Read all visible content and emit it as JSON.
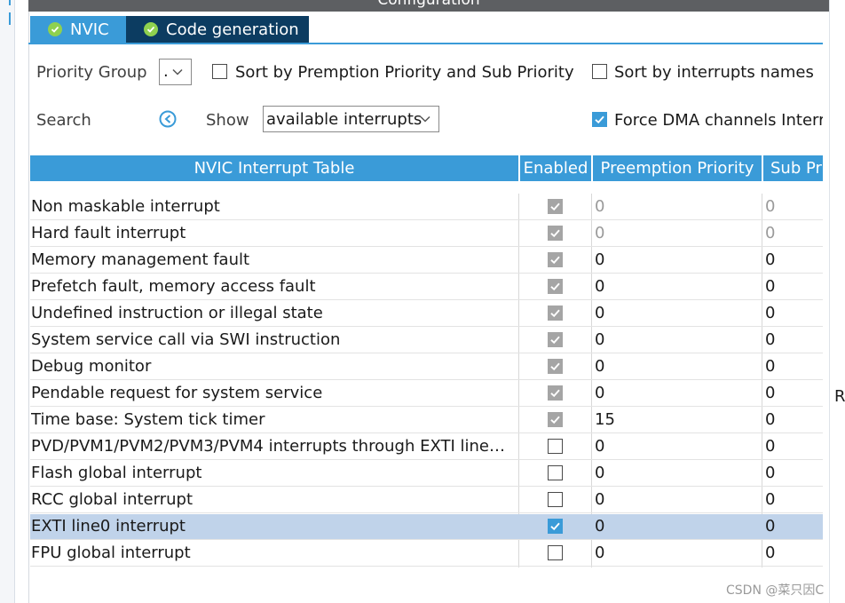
{
  "window": {
    "title": "Configuration"
  },
  "tabs": [
    {
      "label": "NVIC"
    },
    {
      "label": "Code generation"
    }
  ],
  "toolbar": {
    "priority_group_label": "Priority Group",
    "priority_group_value": ".",
    "sort_premption_label": "Sort by Premption Priority and Sub Priority",
    "sort_premption_checked": false,
    "sort_names_label": "Sort by interrupts names",
    "sort_names_checked": false,
    "search_label": "Search",
    "search_icon": "search-clear-icon",
    "show_label": "Show",
    "show_value": "available interrupts",
    "force_dma_label": "Force DMA channels Interr",
    "force_dma_checked": true
  },
  "table": {
    "columns": [
      "NVIC Interrupt Table",
      "Enabled",
      "Preemption Priority",
      "Sub Pr"
    ],
    "rows": [
      {
        "name": "Non maskable interrupt",
        "enabled": true,
        "locked": true,
        "preemption": "0",
        "sub": "0",
        "dim": true
      },
      {
        "name": "Hard fault interrupt",
        "enabled": true,
        "locked": true,
        "preemption": "0",
        "sub": "0",
        "dim": true
      },
      {
        "name": "Memory management fault",
        "enabled": true,
        "locked": true,
        "preemption": "0",
        "sub": "0"
      },
      {
        "name": "Prefetch fault, memory access fault",
        "enabled": true,
        "locked": true,
        "preemption": "0",
        "sub": "0"
      },
      {
        "name": "Undefined instruction or illegal state",
        "enabled": true,
        "locked": true,
        "preemption": "0",
        "sub": "0"
      },
      {
        "name": "System service call via SWI instruction",
        "enabled": true,
        "locked": true,
        "preemption": "0",
        "sub": "0"
      },
      {
        "name": "Debug monitor",
        "enabled": true,
        "locked": true,
        "preemption": "0",
        "sub": "0"
      },
      {
        "name": "Pendable request for system service",
        "enabled": true,
        "locked": true,
        "preemption": "0",
        "sub": "0"
      },
      {
        "name": "Time base: System tick timer",
        "enabled": true,
        "locked": true,
        "preemption": "15",
        "sub": "0"
      },
      {
        "name": "PVD/PVM1/PVM2/PVM3/PVM4 interrupts through EXTI line…",
        "enabled": false,
        "preemption": "0",
        "sub": "0"
      },
      {
        "name": "Flash global interrupt",
        "enabled": false,
        "preemption": "0",
        "sub": "0"
      },
      {
        "name": "RCC global interrupt",
        "enabled": false,
        "preemption": "0",
        "sub": "0"
      },
      {
        "name": "EXTI line0 interrupt",
        "enabled": true,
        "selected": true,
        "preemption": "0",
        "sub": "0"
      },
      {
        "name": "FPU global interrupt",
        "enabled": false,
        "preemption": "0",
        "sub": "0"
      }
    ]
  },
  "stray_text": "R",
  "watermark": "CSDN @菜只因C",
  "colors": {
    "accent": "#3a9bd8",
    "dark_tab": "#0c3c61",
    "selected_row": "#c0d3ea",
    "tab_check": "#8fd14f"
  }
}
